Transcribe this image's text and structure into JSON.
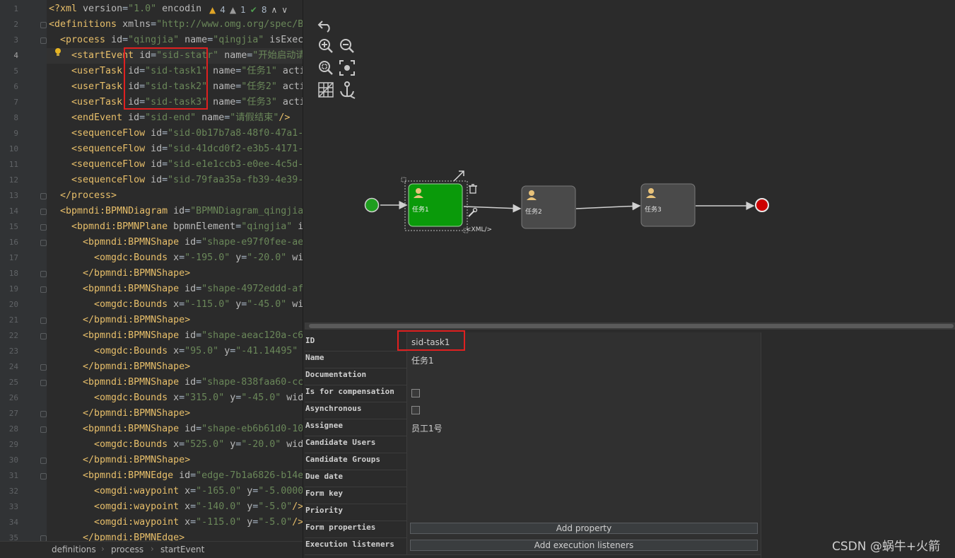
{
  "editor": {
    "line_numbers": [
      "1",
      "2",
      "3",
      "4",
      "5",
      "6",
      "7",
      "8",
      "9",
      "10",
      "11",
      "12",
      "13",
      "14",
      "15",
      "16",
      "17",
      "18",
      "19",
      "20",
      "21",
      "22",
      "23",
      "24",
      "25",
      "26",
      "27",
      "28",
      "29",
      "30",
      "31",
      "32",
      "33",
      "34",
      "35"
    ],
    "lines": [
      [
        {
          "c": "pi",
          "t": "<?xml "
        },
        {
          "c": "attr",
          "t": "version"
        },
        {
          "c": "plain",
          "t": "="
        },
        {
          "c": "val",
          "t": "\"1.0\""
        },
        {
          "c": "attr",
          "t": " encodin"
        }
      ],
      [
        {
          "c": "tag",
          "t": "<definitions "
        },
        {
          "c": "attr",
          "t": "xmlns"
        },
        {
          "c": "plain",
          "t": "="
        },
        {
          "c": "val",
          "t": "\"http://www.omg.org/spec/B"
        }
      ],
      [
        {
          "c": "tag",
          "t": "  <process "
        },
        {
          "c": "attr",
          "t": "id"
        },
        {
          "c": "plain",
          "t": "="
        },
        {
          "c": "val",
          "t": "\"qingjia\""
        },
        {
          "c": "attr",
          "t": " name"
        },
        {
          "c": "plain",
          "t": "="
        },
        {
          "c": "val",
          "t": "\"qingjia\""
        },
        {
          "c": "attr",
          "t": " isExec"
        }
      ],
      [
        {
          "c": "tag",
          "t": "    <startEvent "
        },
        {
          "c": "attr",
          "t": "id"
        },
        {
          "c": "plain",
          "t": "="
        },
        {
          "c": "val",
          "t": "\"sid-statr\""
        },
        {
          "c": "attr",
          "t": " name"
        },
        {
          "c": "plain",
          "t": "="
        },
        {
          "c": "val",
          "t": "\"开始启动请"
        }
      ],
      [
        {
          "c": "tag",
          "t": "    <userTask "
        },
        {
          "c": "attr",
          "t": "id"
        },
        {
          "c": "plain",
          "t": "="
        },
        {
          "c": "val",
          "t": "\"sid-task1\""
        },
        {
          "c": "attr",
          "t": " name"
        },
        {
          "c": "plain",
          "t": "="
        },
        {
          "c": "val",
          "t": "\"任务1\""
        },
        {
          "c": "attr",
          "t": " acti"
        }
      ],
      [
        {
          "c": "tag",
          "t": "    <userTask "
        },
        {
          "c": "attr",
          "t": "id"
        },
        {
          "c": "plain",
          "t": "="
        },
        {
          "c": "val",
          "t": "\"sid-task2\""
        },
        {
          "c": "attr",
          "t": " name"
        },
        {
          "c": "plain",
          "t": "="
        },
        {
          "c": "val",
          "t": "\"任务2\""
        },
        {
          "c": "attr",
          "t": " acti"
        }
      ],
      [
        {
          "c": "tag",
          "t": "    <userTask "
        },
        {
          "c": "attr",
          "t": "id"
        },
        {
          "c": "plain",
          "t": "="
        },
        {
          "c": "val",
          "t": "\"sid-task3\""
        },
        {
          "c": "attr",
          "t": " name"
        },
        {
          "c": "plain",
          "t": "="
        },
        {
          "c": "val",
          "t": "\"任务3\""
        },
        {
          "c": "attr",
          "t": " acti"
        }
      ],
      [
        {
          "c": "tag",
          "t": "    <endEvent "
        },
        {
          "c": "attr",
          "t": "id"
        },
        {
          "c": "plain",
          "t": "="
        },
        {
          "c": "val",
          "t": "\"sid-end\""
        },
        {
          "c": "attr",
          "t": " name"
        },
        {
          "c": "plain",
          "t": "="
        },
        {
          "c": "val",
          "t": "\"请假结束\""
        },
        {
          "c": "tag",
          "t": "/>"
        }
      ],
      [
        {
          "c": "tag",
          "t": "    <sequenceFlow "
        },
        {
          "c": "attr",
          "t": "id"
        },
        {
          "c": "plain",
          "t": "="
        },
        {
          "c": "val",
          "t": "\"sid-0b17b7a8-48f0-47a1-"
        }
      ],
      [
        {
          "c": "tag",
          "t": "    <sequenceFlow "
        },
        {
          "c": "attr",
          "t": "id"
        },
        {
          "c": "plain",
          "t": "="
        },
        {
          "c": "val",
          "t": "\"sid-41dcd0f2-e3b5-4171-"
        }
      ],
      [
        {
          "c": "tag",
          "t": "    <sequenceFlow "
        },
        {
          "c": "attr",
          "t": "id"
        },
        {
          "c": "plain",
          "t": "="
        },
        {
          "c": "val",
          "t": "\"sid-e1e1ccb3-e0ee-4c5d-"
        }
      ],
      [
        {
          "c": "tag",
          "t": "    <sequenceFlow "
        },
        {
          "c": "attr",
          "t": "id"
        },
        {
          "c": "plain",
          "t": "="
        },
        {
          "c": "val",
          "t": "\"sid-79faa35a-fb39-4e39-"
        }
      ],
      [
        {
          "c": "tag",
          "t": "  </process>"
        }
      ],
      [
        {
          "c": "tag",
          "t": "  <bpmndi:BPMNDiagram "
        },
        {
          "c": "attr",
          "t": "id"
        },
        {
          "c": "plain",
          "t": "="
        },
        {
          "c": "val",
          "t": "\"BPMNDiagram_qingjia"
        }
      ],
      [
        {
          "c": "tag",
          "t": "    <bpmndi:BPMNPlane "
        },
        {
          "c": "attr",
          "t": "bpmnElement"
        },
        {
          "c": "plain",
          "t": "="
        },
        {
          "c": "val",
          "t": "\"qingjia\""
        },
        {
          "c": "attr",
          "t": " i"
        }
      ],
      [
        {
          "c": "tag",
          "t": "      <bpmndi:BPMNShape "
        },
        {
          "c": "attr",
          "t": "id"
        },
        {
          "c": "plain",
          "t": "="
        },
        {
          "c": "val",
          "t": "\"shape-e97f0fee-ae"
        }
      ],
      [
        {
          "c": "tag",
          "t": "        <omgdc:Bounds "
        },
        {
          "c": "attr",
          "t": "x"
        },
        {
          "c": "plain",
          "t": "="
        },
        {
          "c": "val",
          "t": "\"-195.0\""
        },
        {
          "c": "attr",
          "t": " y"
        },
        {
          "c": "plain",
          "t": "="
        },
        {
          "c": "val",
          "t": "\"-20.0\""
        },
        {
          "c": "attr",
          "t": " wi"
        }
      ],
      [
        {
          "c": "tag",
          "t": "      </bpmndi:BPMNShape>"
        }
      ],
      [
        {
          "c": "tag",
          "t": "      <bpmndi:BPMNShape "
        },
        {
          "c": "attr",
          "t": "id"
        },
        {
          "c": "plain",
          "t": "="
        },
        {
          "c": "val",
          "t": "\"shape-4972eddd-af"
        }
      ],
      [
        {
          "c": "tag",
          "t": "        <omgdc:Bounds "
        },
        {
          "c": "attr",
          "t": "x"
        },
        {
          "c": "plain",
          "t": "="
        },
        {
          "c": "val",
          "t": "\"-115.0\""
        },
        {
          "c": "attr",
          "t": " y"
        },
        {
          "c": "plain",
          "t": "="
        },
        {
          "c": "val",
          "t": "\"-45.0\""
        },
        {
          "c": "attr",
          "t": " wi"
        }
      ],
      [
        {
          "c": "tag",
          "t": "      </bpmndi:BPMNShape>"
        }
      ],
      [
        {
          "c": "tag",
          "t": "      <bpmndi:BPMNShape "
        },
        {
          "c": "attr",
          "t": "id"
        },
        {
          "c": "plain",
          "t": "="
        },
        {
          "c": "val",
          "t": "\"shape-aeac120a-c6"
        }
      ],
      [
        {
          "c": "tag",
          "t": "        <omgdc:Bounds "
        },
        {
          "c": "attr",
          "t": "x"
        },
        {
          "c": "plain",
          "t": "="
        },
        {
          "c": "val",
          "t": "\"95.0\""
        },
        {
          "c": "attr",
          "t": " y"
        },
        {
          "c": "plain",
          "t": "="
        },
        {
          "c": "val",
          "t": "\"-41.14495\""
        }
      ],
      [
        {
          "c": "tag",
          "t": "      </bpmndi:BPMNShape>"
        }
      ],
      [
        {
          "c": "tag",
          "t": "      <bpmndi:BPMNShape "
        },
        {
          "c": "attr",
          "t": "id"
        },
        {
          "c": "plain",
          "t": "="
        },
        {
          "c": "val",
          "t": "\"shape-838faa60-cc"
        }
      ],
      [
        {
          "c": "tag",
          "t": "        <omgdc:Bounds "
        },
        {
          "c": "attr",
          "t": "x"
        },
        {
          "c": "plain",
          "t": "="
        },
        {
          "c": "val",
          "t": "\"315.0\""
        },
        {
          "c": "attr",
          "t": " y"
        },
        {
          "c": "plain",
          "t": "="
        },
        {
          "c": "val",
          "t": "\"-45.0\""
        },
        {
          "c": "attr",
          "t": " wid"
        }
      ],
      [
        {
          "c": "tag",
          "t": "      </bpmndi:BPMNShape>"
        }
      ],
      [
        {
          "c": "tag",
          "t": "      <bpmndi:BPMNShape "
        },
        {
          "c": "attr",
          "t": "id"
        },
        {
          "c": "plain",
          "t": "="
        },
        {
          "c": "val",
          "t": "\"shape-eb6b61d0-10"
        }
      ],
      [
        {
          "c": "tag",
          "t": "        <omgdc:Bounds "
        },
        {
          "c": "attr",
          "t": "x"
        },
        {
          "c": "plain",
          "t": "="
        },
        {
          "c": "val",
          "t": "\"525.0\""
        },
        {
          "c": "attr",
          "t": " y"
        },
        {
          "c": "plain",
          "t": "="
        },
        {
          "c": "val",
          "t": "\"-20.0\""
        },
        {
          "c": "attr",
          "t": " wid"
        }
      ],
      [
        {
          "c": "tag",
          "t": "      </bpmndi:BPMNShape>"
        }
      ],
      [
        {
          "c": "tag",
          "t": "      <bpmndi:BPMNEdge "
        },
        {
          "c": "attr",
          "t": "id"
        },
        {
          "c": "plain",
          "t": "="
        },
        {
          "c": "val",
          "t": "\"edge-7b1a6826-b14e"
        }
      ],
      [
        {
          "c": "tag",
          "t": "        <omgdi:waypoint "
        },
        {
          "c": "attr",
          "t": "x"
        },
        {
          "c": "plain",
          "t": "="
        },
        {
          "c": "val",
          "t": "\"-165.0\""
        },
        {
          "c": "attr",
          "t": " y"
        },
        {
          "c": "plain",
          "t": "="
        },
        {
          "c": "val",
          "t": "\"-5.0000"
        }
      ],
      [
        {
          "c": "tag",
          "t": "        <omgdi:waypoint "
        },
        {
          "c": "attr",
          "t": "x"
        },
        {
          "c": "plain",
          "t": "="
        },
        {
          "c": "val",
          "t": "\"-140.0\""
        },
        {
          "c": "attr",
          "t": " y"
        },
        {
          "c": "plain",
          "t": "="
        },
        {
          "c": "val",
          "t": "\"-5.0\""
        },
        {
          "c": "tag",
          "t": "/>"
        }
      ],
      [
        {
          "c": "tag",
          "t": "        <omgdi:waypoint "
        },
        {
          "c": "attr",
          "t": "x"
        },
        {
          "c": "plain",
          "t": "="
        },
        {
          "c": "val",
          "t": "\"-115.0\""
        },
        {
          "c": "attr",
          "t": " y"
        },
        {
          "c": "plain",
          "t": "="
        },
        {
          "c": "val",
          "t": "\"-5.0\""
        },
        {
          "c": "tag",
          "t": "/>"
        }
      ],
      [
        {
          "c": "tag",
          "t": "      </bpmndi:BPMNEdge>"
        }
      ]
    ],
    "inspections": {
      "warnings": "4",
      "weak_warnings": "1",
      "typos": "8"
    },
    "breadcrumbs": [
      "definitions",
      "process",
      "startEvent"
    ]
  },
  "diagram": {
    "nodes": [
      {
        "kind": "start",
        "label": ""
      },
      {
        "kind": "task",
        "label": "任务1",
        "selected": true
      },
      {
        "kind": "task",
        "label": "任务2"
      },
      {
        "kind": "task",
        "label": "任务3"
      },
      {
        "kind": "end",
        "label": ""
      }
    ],
    "selection_hint": "<XML/>",
    "colors": {
      "start": "#1f9e1f",
      "end": "#cc0000",
      "selected_task": "#0a9a0a",
      "task": "#4a4a4a"
    },
    "toolbar_icons": [
      "undo-icon",
      "zoom-in-icon",
      "zoom-out-icon",
      "zoom-fit-icon",
      "zoom-actual-icon",
      "grid-icon",
      "anchor-icon"
    ]
  },
  "properties": {
    "rows": [
      {
        "key": "ID",
        "value": "sid-task1",
        "type": "text"
      },
      {
        "key": "Name",
        "value": "任务1",
        "type": "text"
      },
      {
        "key": "Documentation",
        "value": "",
        "type": "text"
      },
      {
        "key": "Is for compensation",
        "value": "",
        "type": "checkbox"
      },
      {
        "key": "Asynchronous",
        "value": "",
        "type": "checkbox"
      },
      {
        "key": "Assignee",
        "value": "员工1号",
        "type": "text"
      },
      {
        "key": "Candidate Users",
        "value": "",
        "type": "text"
      },
      {
        "key": "Candidate Groups",
        "value": "",
        "type": "text"
      },
      {
        "key": "Due date",
        "value": "",
        "type": "text"
      },
      {
        "key": "Form key",
        "value": "",
        "type": "text"
      },
      {
        "key": "Priority",
        "value": "",
        "type": "text"
      },
      {
        "key": "Form properties",
        "value": "Add property",
        "type": "button"
      },
      {
        "key": "Execution listeners",
        "value": "Add execution listeners",
        "type": "button"
      }
    ]
  },
  "watermark": "CSDN @蜗牛+火箭"
}
